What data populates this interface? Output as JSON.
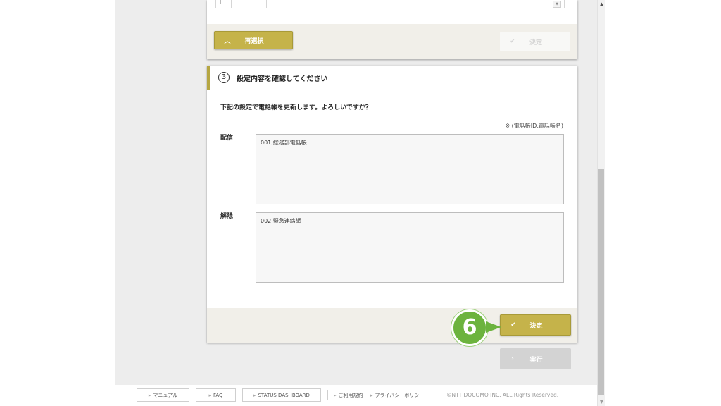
{
  "reselect_button": {
    "label": "再選択",
    "icon": "chevron-up-icon"
  },
  "top_decide_button": {
    "label": "決定",
    "icon": "check-icon"
  },
  "section": {
    "number": "3",
    "title": "設定内容を確認してください",
    "message": "下記の設定で電話帳を更新します。よろしいですか？",
    "note": "※ (電話帳ID,電話帳名)",
    "deliver_label": "配信",
    "deliver_value": "001,総務部電話帳",
    "remove_label": "解除",
    "remove_value": "002,緊急連絡網"
  },
  "decide_button": {
    "label": "決定",
    "icon": "check-icon"
  },
  "execute_button": {
    "label": "実行",
    "icon": "chevron-right-icon"
  },
  "step_badge": {
    "number": "6",
    "color": "#6cb33e"
  },
  "footer": {
    "manual": "マニュアル",
    "faq": "FAQ",
    "status": "STATUS DASHBOARD",
    "terms": "ご利用規約",
    "privacy": "プライバシーポリシー",
    "copyright": "©NTT DOCOMO INC. ALL Rights Reserved."
  },
  "colors": {
    "accent": "#c5b34a",
    "panel_bg": "#ededed",
    "footer_bar": "#f1efe9"
  }
}
